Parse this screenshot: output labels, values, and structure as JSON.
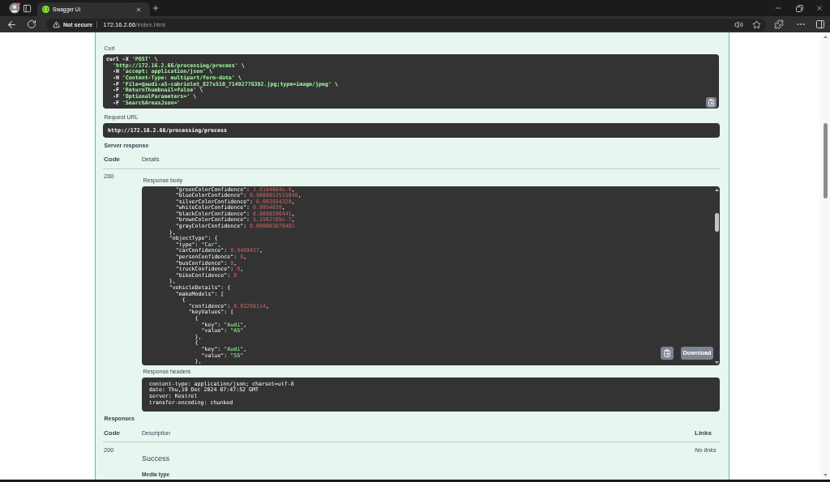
{
  "browser": {
    "tab": {
      "title": "Swagger UI",
      "selected": true
    },
    "address_bar": {
      "security_label": "Not secure",
      "host": "172.16.2.66",
      "path": "/index.html"
    }
  },
  "curl": {
    "label": "Curl",
    "lines": [
      "curl -X 'POST' \\",
      "  'http://172.16.2.66/processing/process' \\",
      "  -H 'accept: application/json' \\",
      "  -H 'Content-Type: multipart/form-data' \\",
      "  -F 'File=@audi-a5-cabriolet_827x510_71492776392.jpg;type=image/jpeg' \\",
      "  -F 'ReturnThumbnail=false' \\",
      "  -F 'OptionalParameters=' \\",
      "  -F 'SearchAreasJson='"
    ]
  },
  "request_url": {
    "label": "Request URL",
    "value": "http://172.16.2.66/processing/process"
  },
  "server_response": {
    "label": "Server response",
    "columns": [
      "Code",
      "Details"
    ],
    "code": "200",
    "response_body": {
      "label": "Response body",
      "lines": [
        "        \"greenColorConfidence\": 1.8104684e-9,",
        "        \"blueColorConfidence\": 0.0000011515848,",
        "        \"silverColorConfidence\": 0.003554329,",
        "        \"whiteColorConfidence\": 0.9954038,",
        "        \"blackColorConfidence\": 0.0000290441,",
        "        \"brownColorConfidence\": 5.1562785e-7,",
        "        \"grayColorConfidence\": 0.000003879401",
        "      },",
        "      \"objectType\": {",
        "        \"type\": \"Car\",",
        "        \"carConfidence\": 0.9469437,",
        "        \"personConfidence\": 0,",
        "        \"busConfidence\": 0,",
        "        \"truckConfidence\": 0,",
        "        \"bikeConfidence\": 0",
        "      },",
        "      \"vehicleDetails\": {",
        "        \"makeModels\": [",
        "          {",
        "            \"confidence\": 0.92298114,",
        "            \"keyValues\": [",
        "              {",
        "                \"key\": \"Audi\",",
        "                \"value\": \"A5\"",
        "              },",
        "              {",
        "                \"key\": \"Audi\",",
        "                \"value\": \"S5\"",
        "              },"
      ],
      "download_button": "Download"
    },
    "response_headers": {
      "label": "Response headers",
      "lines": [
        "content-type: application/json; charset=utf-8",
        "date: Thu,19 Dec 2024 07:47:52 GMT",
        "server: Kestrel",
        "transfer-encoding: chunked"
      ]
    }
  },
  "responses": {
    "label": "Responses",
    "columns": [
      "Code",
      "Description",
      "Links"
    ],
    "rows": [
      {
        "code": "200",
        "description": "Success",
        "links": "No links",
        "media_type_label": "Media type"
      }
    ]
  }
}
